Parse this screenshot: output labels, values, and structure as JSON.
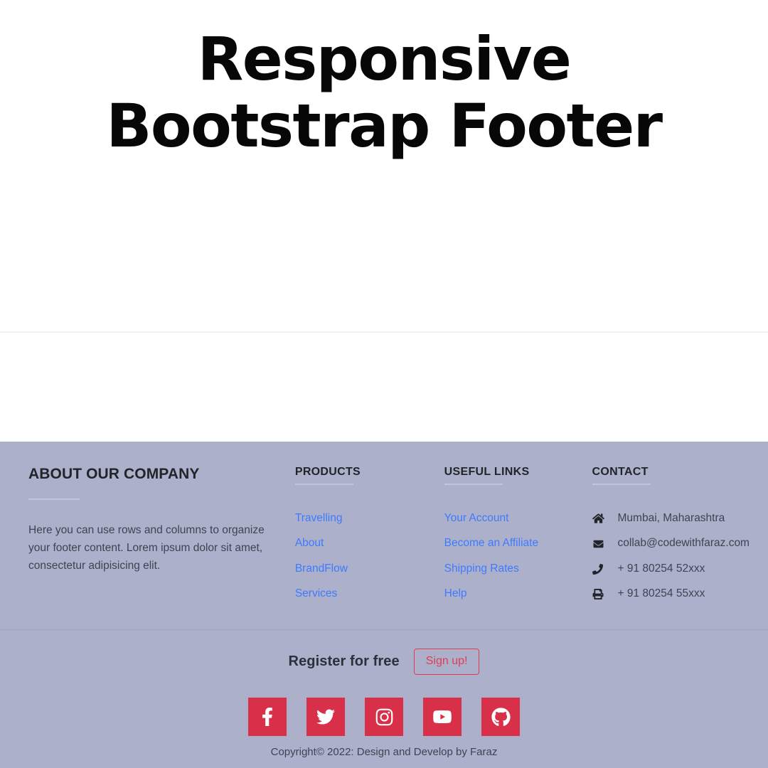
{
  "hero": {
    "title": "Responsive Bootstrap Footer"
  },
  "footer": {
    "about": {
      "heading": "ABOUT OUR COMPANY",
      "text": "Here you can use rows and columns to organize your footer content. Lorem ipsum dolor sit amet, consectetur adipisicing elit."
    },
    "products": {
      "heading": "PRODUCTS",
      "links": [
        {
          "label": "Travelling"
        },
        {
          "label": "About"
        },
        {
          "label": "BrandFlow"
        },
        {
          "label": "Services"
        }
      ]
    },
    "useful_links": {
      "heading": "USEFUL LINKS",
      "links": [
        {
          "label": "Your Account"
        },
        {
          "label": "Become an Affiliate"
        },
        {
          "label": "Shipping Rates"
        },
        {
          "label": "Help"
        }
      ]
    },
    "contact": {
      "heading": "CONTACT",
      "items": [
        {
          "icon": "home-icon",
          "label": "Mumbai, Maharashtra"
        },
        {
          "icon": "envelope-icon",
          "label": "collab@codewithfaraz.com"
        },
        {
          "icon": "phone-icon",
          "label": "+ 91 80254 52xxx"
        },
        {
          "icon": "print-icon",
          "label": "+ 91 80254 55xxx"
        }
      ]
    },
    "register": {
      "text": "Register for free",
      "button_label": "Sign up!"
    },
    "social": [
      {
        "icon": "facebook-icon",
        "name": "Facebook"
      },
      {
        "icon": "twitter-icon",
        "name": "Twitter"
      },
      {
        "icon": "instagram-icon",
        "name": "Instagram"
      },
      {
        "icon": "youtube-icon",
        "name": "YouTube"
      },
      {
        "icon": "github-icon",
        "name": "GitHub"
      }
    ],
    "copyright": "Copyright© 2022: Design and Develop by Faraz"
  },
  "colors": {
    "footer_background": "#adb0cb",
    "link": "#3d7bfd",
    "accent": "#d9304a",
    "signup_border": "#dc3e52",
    "heading": "#212529",
    "body_text": "#3e4352"
  }
}
